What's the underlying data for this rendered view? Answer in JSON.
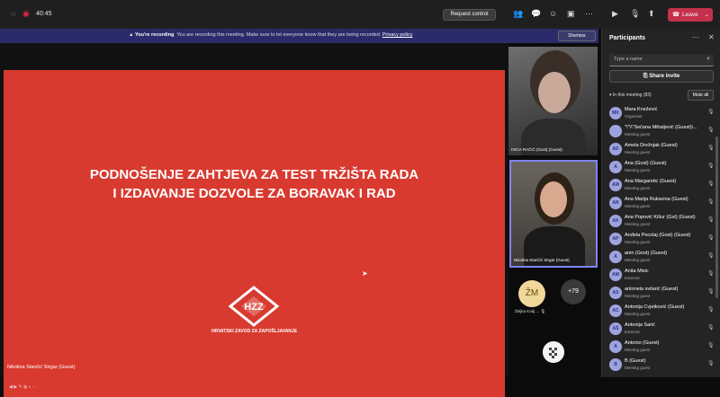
{
  "topbar": {
    "timer": "40:45",
    "request_control": "Request control",
    "leave": "Leave"
  },
  "banner": {
    "title": "You're recording",
    "message": "You are recording this meeting. Make sure to let everyone know that they are being recorded.",
    "link": "Privacy policy",
    "dismiss": "Dismiss"
  },
  "slide": {
    "title_line1": "PODNOŠENJE ZAHTJEVA ZA TEST TRŽIŠTA RADA",
    "title_line2": "I IZDAVANJE DOZVOLE ZA BORAVAK I RAD",
    "logo_letters": "HZZ",
    "logo_text": "HRVATSKI ZAVOD ZA ZAPOŠLJAVANJE"
  },
  "presenter_label": "Nikolina Stančić Strgar (Guest)",
  "videos": [
    {
      "label": "IVICA RAČIĆ (Gost) (Guest)"
    },
    {
      "label": "Nikolina Stančić Strgar (Guest)"
    }
  ],
  "avatar_tile": {
    "initials": "ŽM",
    "label": "Željka Kralj ..."
  },
  "more_participants": "+79",
  "panel": {
    "title": "Participants",
    "search_placeholder": "Type a name",
    "share_invite": "Share invite",
    "in_meeting": "In this meeting (83)",
    "mute_all": "Mute all",
    "participants": [
      {
        "initials": "MK",
        "name": "Mara Knežević",
        "role": "Organiser"
      },
      {
        "initials": "",
        "name": "\"\\\"\\\\\"Sečana Mihaljević (Guest)\\...",
        "role": "Meeting guest"
      },
      {
        "initials": "AD",
        "name": "Amela Drežnjak (Guest)",
        "role": "Meeting guest"
      },
      {
        "initials": "A",
        "name": "Ana (Gost) (Guest)",
        "role": "Meeting guest"
      },
      {
        "initials": "AM",
        "name": "Ana Margaretic (Guest)",
        "role": "Meeting guest"
      },
      {
        "initials": "AR",
        "name": "Ana Marija Rukavina (Guest)",
        "role": "Meeting guest"
      },
      {
        "initials": "AK",
        "name": "Ana Popović Kišur (Gst) (Guest)",
        "role": "Meeting guest"
      },
      {
        "initials": "AP",
        "name": "Anđela Pecolaj (Gost) (Guest)",
        "role": "Meeting guest"
      },
      {
        "initials": "A",
        "name": "anin (Gost) (Guest)",
        "role": "Meeting guest"
      },
      {
        "initials": "AM",
        "name": "Anita Misic",
        "role": "External"
      },
      {
        "initials": "AS",
        "name": "antonela svilarić (Guest)",
        "role": "Meeting guest"
      },
      {
        "initials": "AC",
        "name": "Antonija Cvjetković (Guest)",
        "role": "Meeting guest"
      },
      {
        "initials": "AŠ",
        "name": "Antonija Šarić",
        "role": "External"
      },
      {
        "initials": "A",
        "name": "Antonio (Guest)",
        "role": "Meeting guest"
      },
      {
        "initials": "B",
        "name": "B (Guest)",
        "role": "Meeting guest"
      }
    ]
  },
  "colors": {
    "slide_bg": "#d83a30",
    "leave": "#c4314b",
    "banner": "#2b2b6b",
    "accent": "#7f85f5"
  }
}
